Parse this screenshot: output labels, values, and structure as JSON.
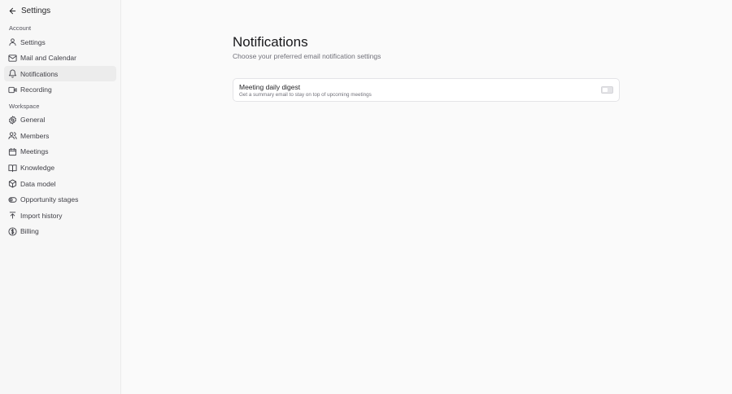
{
  "header": {
    "title": "Settings"
  },
  "sections": {
    "account": {
      "label": "Account",
      "items": [
        {
          "label": "Settings",
          "icon": "user-icon"
        },
        {
          "label": "Mail and Calendar",
          "icon": "mail-icon"
        },
        {
          "label": "Notifications",
          "icon": "bell-icon",
          "active": true
        },
        {
          "label": "Recording",
          "icon": "video-icon"
        }
      ]
    },
    "workspace": {
      "label": "Workspace",
      "items": [
        {
          "label": "General",
          "icon": "gear-icon"
        },
        {
          "label": "Members",
          "icon": "users-icon"
        },
        {
          "label": "Meetings",
          "icon": "calendar-icon"
        },
        {
          "label": "Knowledge",
          "icon": "book-icon"
        },
        {
          "label": "Data model",
          "icon": "box-icon"
        },
        {
          "label": "Opportunity stages",
          "icon": "toggle-icon"
        },
        {
          "label": "Import history",
          "icon": "import-icon"
        },
        {
          "label": "Billing",
          "icon": "dollar-icon"
        }
      ]
    }
  },
  "main": {
    "title": "Notifications",
    "subtitle": "Choose your preferred email notification settings",
    "settings": [
      {
        "title": "Meeting daily digest",
        "description": "Get a summary email to stay on top of upcoming meetings",
        "enabled": false
      }
    ]
  },
  "colors": {
    "sidebar_bg": "#f7f7f7",
    "active_item_bg": "#ececec",
    "page_bg": "#fafafa"
  }
}
